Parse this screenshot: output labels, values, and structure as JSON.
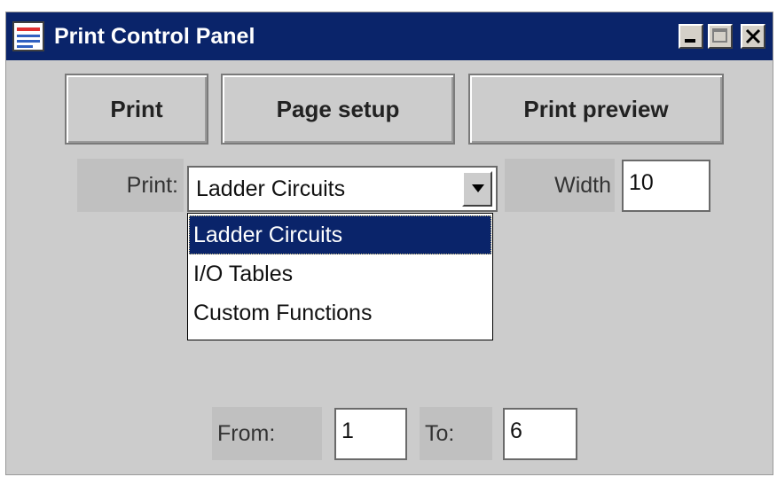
{
  "window": {
    "title": "Print Control Panel",
    "controls": {
      "minimize": "minimize-icon",
      "maximize": "maximize-icon",
      "close": "close-icon"
    }
  },
  "toolbar": {
    "print_label": "Print",
    "page_setup_label": "Page setup",
    "print_preview_label": "Print preview"
  },
  "print_select": {
    "label": "Print:",
    "value": "Ladder Circuits",
    "options": [
      "Ladder Circuits",
      "I/O Tables",
      "Custom Functions"
    ]
  },
  "width": {
    "label": "Width",
    "value": "10"
  },
  "range": {
    "from_label": "From:",
    "from_value": "1",
    "to_label": "To:",
    "to_value": "6"
  },
  "colors": {
    "titlebar": "#0a246a",
    "panel": "#cccccc",
    "selection": "#0a246a"
  }
}
